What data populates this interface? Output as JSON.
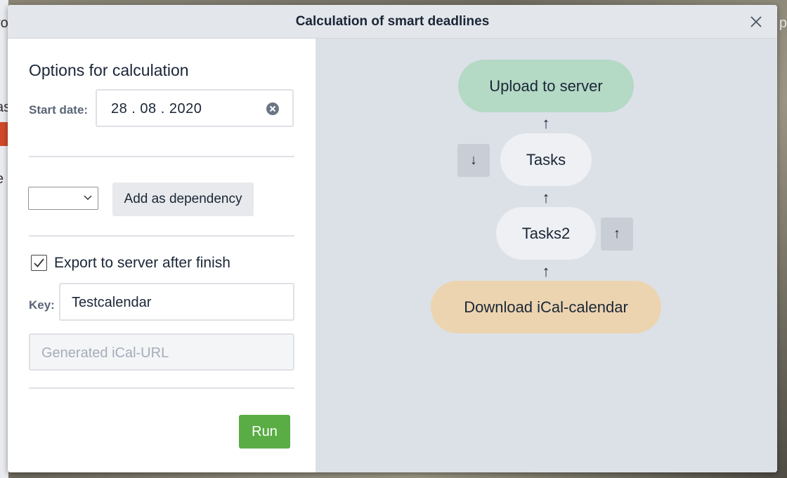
{
  "background": {
    "left_fragments": [
      "ro",
      "as",
      "e"
    ],
    "right_fragment": "p"
  },
  "modal": {
    "title": "Calculation of smart deadlines",
    "close_icon": "close-icon"
  },
  "options": {
    "section_title": "Options for calculation",
    "start_date_label": "Start date:",
    "start_date_value": "28 . 08 . 2020",
    "dependency_select_value": "",
    "add_dependency_label": "Add as dependency",
    "export_checked": true,
    "export_label": "Export to server after finish",
    "key_label": "Key:",
    "key_value": "Testcalendar",
    "ical_url_placeholder": "Generated iCal-URL",
    "ical_url_value": "",
    "run_label": "Run"
  },
  "flow": {
    "nodes": [
      {
        "label": "Upload to server",
        "color": "#b4d9c4"
      },
      {
        "label": "Tasks",
        "color": "#eef0f3"
      },
      {
        "label": "Tasks2",
        "color": "#eef0f3"
      },
      {
        "label": "Download iCal-calendar",
        "color": "#ecd4b0"
      }
    ],
    "arrow_up": "↑",
    "move_down": "↓",
    "move_up": "↑"
  },
  "colors": {
    "run_button": "#5aac44",
    "right_pane_bg": "#dce1e8",
    "header_bg": "#e3e6ea"
  }
}
